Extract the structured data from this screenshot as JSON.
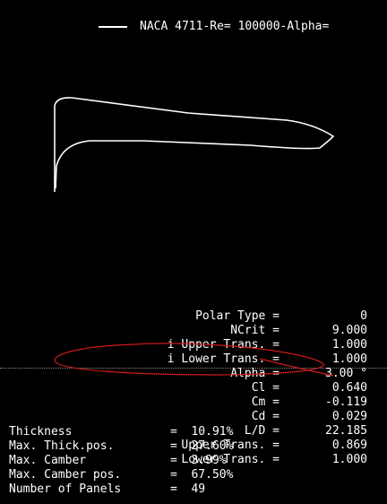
{
  "legend": {
    "label": "NACA 4711-Re=  100000-Alpha="
  },
  "polar_params": [
    {
      "label": "Polar Type =",
      "value": "0"
    },
    {
      "label": "NCrit =",
      "value": "9.000"
    },
    {
      "label": "i Upper Trans. =",
      "value": "1.000"
    },
    {
      "label": "i Lower Trans. =",
      "value": "1.000"
    },
    {
      "label": "Alpha =",
      "value": "3.00 °"
    },
    {
      "label": "Cl =",
      "value": "0.640"
    },
    {
      "label": "Cm =",
      "value": "-0.119"
    },
    {
      "label": "Cd =",
      "value": "0.029"
    },
    {
      "label": "L/D =",
      "value": "22.185"
    },
    {
      "label": "Upper Trans. =",
      "value": "0.869"
    },
    {
      "label": "Lower Trans. =",
      "value": "1.000"
    }
  ],
  "geometry": [
    {
      "label": "Thickness",
      "value": "=  10.91%"
    },
    {
      "label": "Max. Thick.pos.",
      "value": "=  27.60%"
    },
    {
      "label": "Max. Camber",
      "value": "=  3.99%"
    },
    {
      "label": "Max. Camber pos.",
      "value": "=  67.50%"
    },
    {
      "label": "Number of Panels",
      "value": "=  49"
    }
  ],
  "colors": {
    "background": "#000000",
    "text": "#ffffff",
    "annotation": "#cc1b1b",
    "dotted_line": "#8a8a8a"
  }
}
